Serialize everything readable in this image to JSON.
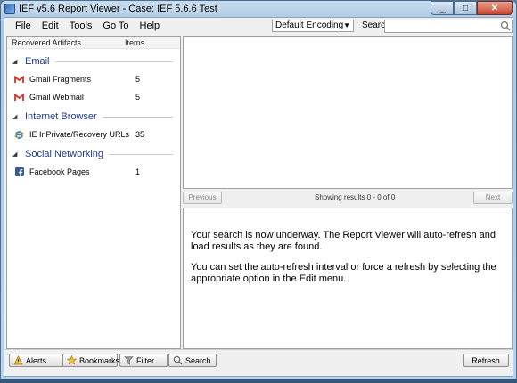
{
  "window": {
    "title": "IEF v5.6 Report Viewer - Case: IEF 5.6.6 Test",
    "controls": {
      "minimize": "▁",
      "maximize": "□",
      "close": "✕"
    }
  },
  "menu": {
    "items": [
      "File",
      "Edit",
      "Tools",
      "Go To",
      "Help"
    ],
    "encoding_value": "Default Encoding",
    "search_label": "Search:",
    "search_value": ""
  },
  "artifacts": {
    "header_name": "Recovered Artifacts",
    "header_count": "Items",
    "groups": [
      {
        "name": "Email",
        "items": [
          {
            "icon": "gmail-icon",
            "name": "Gmail Fragments",
            "count": "5"
          },
          {
            "icon": "gmail-icon",
            "name": "Gmail Webmail",
            "count": "5"
          }
        ]
      },
      {
        "name": "Internet Browser",
        "items": [
          {
            "icon": "internet-explorer-icon",
            "name": "IE InPrivate/Recovery URLs",
            "count": "35"
          }
        ]
      },
      {
        "name": "Social Networking",
        "items": [
          {
            "icon": "facebook-icon",
            "name": "Facebook Pages",
            "count": "1"
          }
        ]
      }
    ]
  },
  "navigation": {
    "previous_label": "Previous",
    "next_label": "Next",
    "status": "Showing results 0 - 0 of 0"
  },
  "message": {
    "paragraph1": "Your search is now underway. The Report Viewer will auto-refresh and load results as they are found.",
    "paragraph2": "You can set the auto-refresh interval or force a refresh by selecting the appropriate option in the Edit menu."
  },
  "toolbar": {
    "alerts_label": "Alerts",
    "bookmarks_label": "Bookmarks",
    "filter_label": "Filter",
    "search_label": "Search",
    "refresh_label": "Refresh"
  },
  "colors": {
    "group_text": "#1f3a8a",
    "gmail_red": "#d93025",
    "facebook_blue": "#3b5998"
  }
}
